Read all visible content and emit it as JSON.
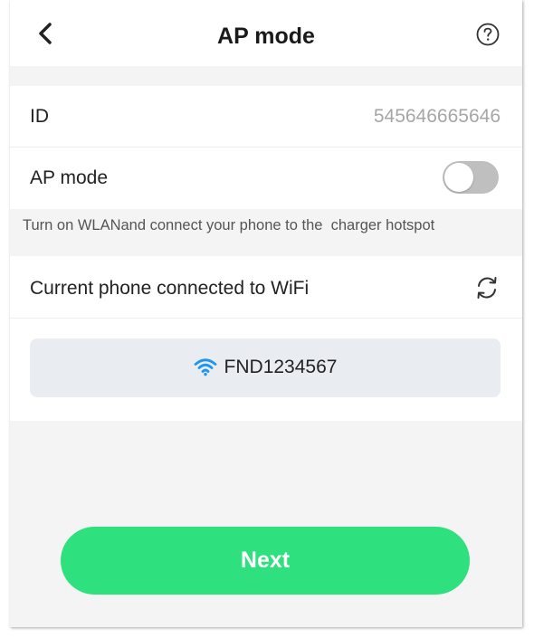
{
  "header": {
    "title": "AP mode",
    "back_icon": "chevron-left-icon",
    "help_icon": "help-circle-icon"
  },
  "device": {
    "id_label": "ID",
    "id_value": "545646665646",
    "ap_mode_label": "AP mode",
    "ap_mode_enabled": false
  },
  "hint": "Turn on WLANand connect your phone to the  charger hotspot",
  "wifi": {
    "label": "Current phone connected to WiFi",
    "refresh_icon": "refresh-icon",
    "ssid": "FND1234567",
    "wifi_icon_color": "#1e96f0"
  },
  "actions": {
    "next_label": "Next",
    "next_color": "#2ee17e"
  }
}
